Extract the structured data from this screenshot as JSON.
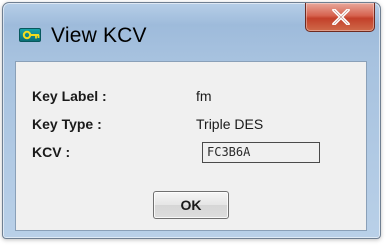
{
  "window": {
    "title": "View KCV",
    "app_icon": "key-icon",
    "close_icon": "close-x-icon"
  },
  "fields": [
    {
      "label": "Key Label :",
      "value": "fm"
    },
    {
      "label": "Key Type :",
      "value": "Triple DES"
    },
    {
      "label": "KCV :",
      "value": "FC3B6A"
    }
  ],
  "buttons": {
    "ok_label": "OK"
  },
  "colors": {
    "frame": "#a7c2df",
    "close_button": "#c3402a",
    "client_background": "#f0f0f0",
    "icon_teal": "#0a8a91",
    "key_yellow": "#e8d21c"
  }
}
